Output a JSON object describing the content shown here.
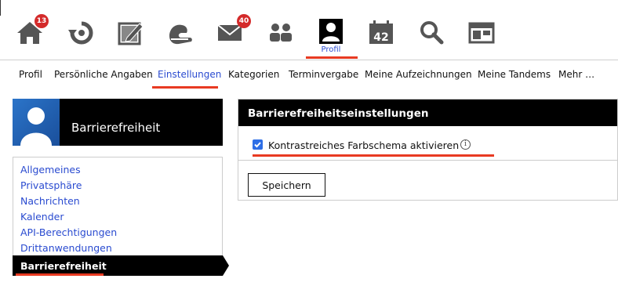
{
  "topnav": {
    "icons": [
      {
        "name": "home-icon",
        "badge": "13"
      },
      {
        "name": "circle-arrow-icon",
        "badge": ""
      },
      {
        "name": "edit-icon",
        "badge": ""
      },
      {
        "name": "hand-icon",
        "badge": ""
      },
      {
        "name": "mail-icon",
        "badge": "40"
      },
      {
        "name": "people-icon",
        "badge": ""
      },
      {
        "name": "profile-icon",
        "badge": ""
      },
      {
        "name": "calendar-icon",
        "badge": ""
      },
      {
        "name": "search-icon",
        "badge": ""
      },
      {
        "name": "window-icon",
        "badge": ""
      }
    ],
    "calendar_day": "42",
    "active_label": "Profil"
  },
  "tabs": {
    "items": [
      "Profil",
      "Persönliche Angaben",
      "Einstellungen",
      "Kategorien",
      "Terminvergabe",
      "Meine Aufzeichnungen",
      "Meine Tandems",
      "Mehr …"
    ],
    "active": "Einstellungen"
  },
  "sidebar": {
    "title": "Barrierefreiheit",
    "items": [
      "Allgemeines",
      "Privatsphäre",
      "Nachrichten",
      "Kalender",
      "API-Berechtigungen",
      "Drittanwendungen"
    ],
    "active_item": "Barrierefreiheit"
  },
  "settings": {
    "title": "Barrierefreiheitseinstellungen",
    "checkbox_label": "Kontrastreiches Farbschema aktivieren",
    "checkbox_checked": true,
    "info_glyph": "i",
    "save_label": "Speichern"
  },
  "colors": {
    "accent": "#2a4bd0",
    "highlight": "#e83a22",
    "badge": "#d42a2a",
    "checkbox": "#2d6ee6"
  }
}
